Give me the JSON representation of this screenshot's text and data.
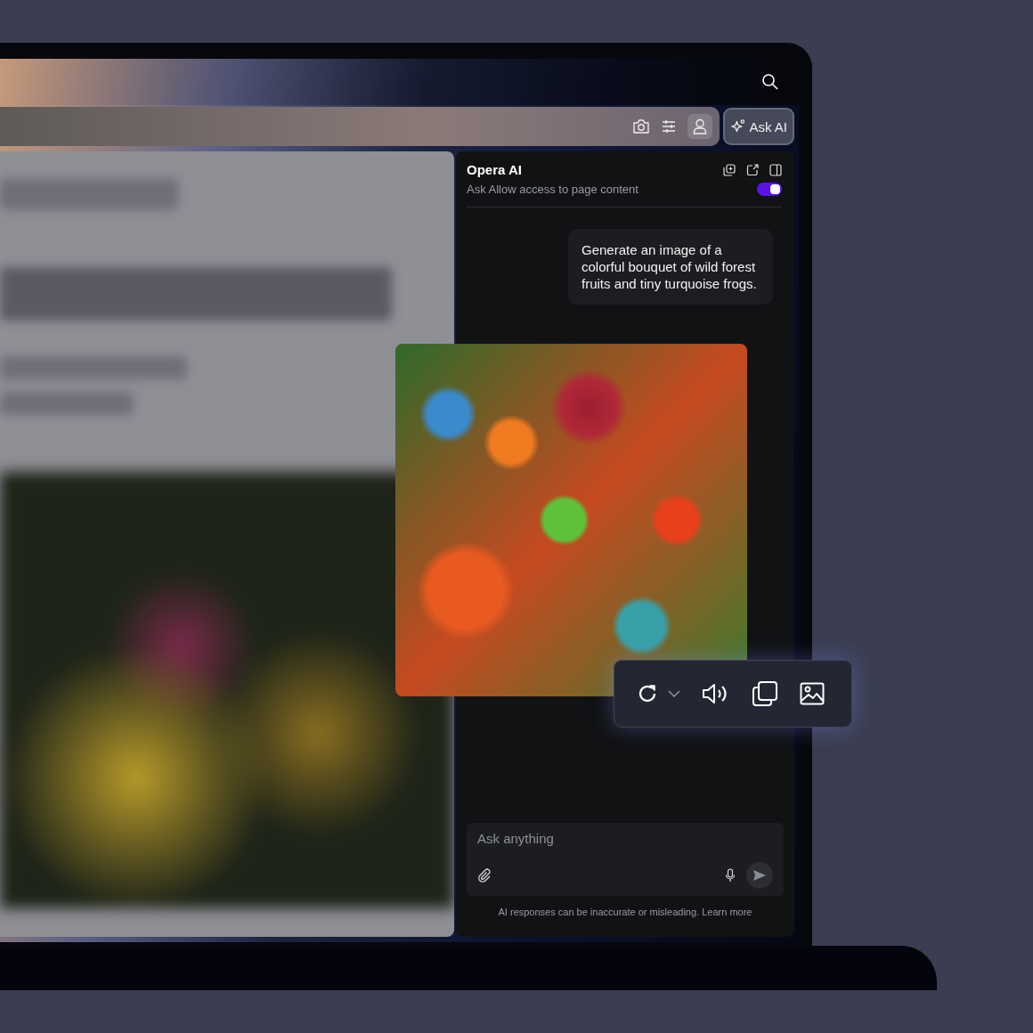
{
  "browser": {
    "ask_ai_button": {
      "label": "Ask AI"
    }
  },
  "ai_panel": {
    "title": "Opera AI",
    "page_access": {
      "label": "Ask Allow access to page content",
      "on": true
    },
    "messages": [
      {
        "kind": "user",
        "text": "Generate an image of a colorful bouquet of wild forest fruits and tiny turquoise frogs."
      },
      {
        "kind": "image"
      }
    ],
    "input": {
      "placeholder": "Ask anything"
    },
    "disclaimer": "AI responses can be inaccurate or misleading.",
    "learn_more": "Learn more"
  }
}
